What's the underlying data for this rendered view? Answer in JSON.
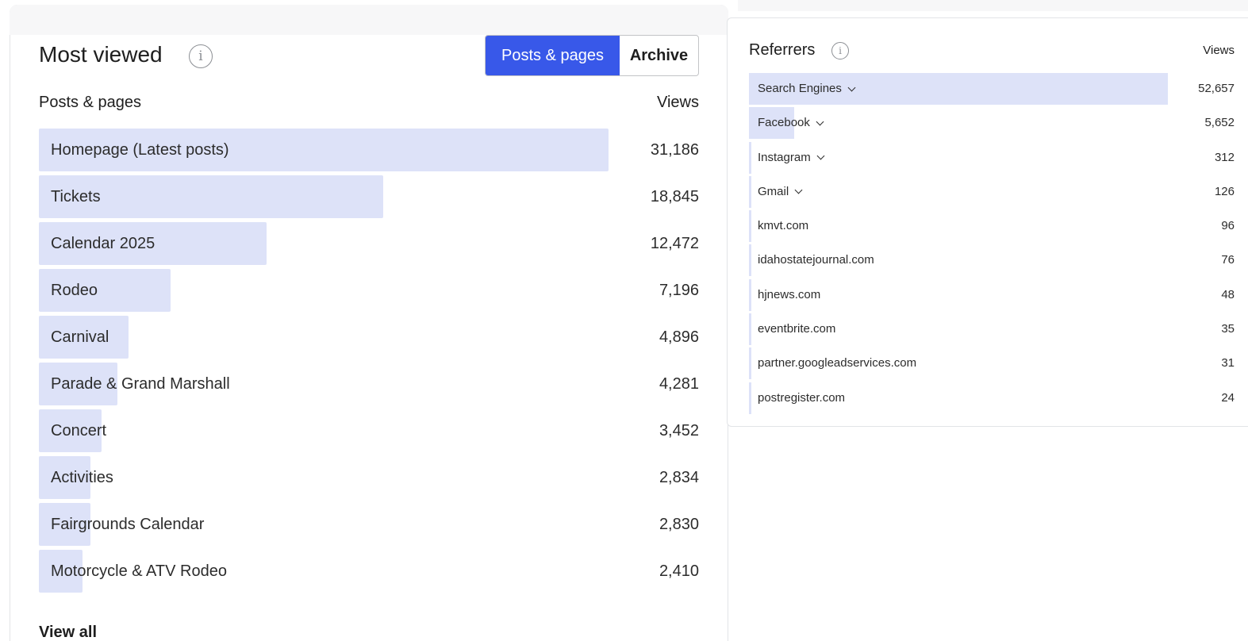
{
  "most_viewed": {
    "title": "Most viewed",
    "tabs": [
      {
        "label": "Posts & pages",
        "active": true
      },
      {
        "label": "Archive",
        "active": false
      }
    ],
    "column_label": "Posts & pages",
    "column_views": "Views",
    "max_value": 31186,
    "rows": [
      {
        "label": "Homepage (Latest posts)",
        "value": "31,186",
        "num": 31186
      },
      {
        "label": "Tickets",
        "value": "18,845",
        "num": 18845
      },
      {
        "label": "Calendar 2025",
        "value": "12,472",
        "num": 12472
      },
      {
        "label": "Rodeo",
        "value": "7,196",
        "num": 7196
      },
      {
        "label": "Carnival",
        "value": "4,896",
        "num": 4896
      },
      {
        "label": "Parade & Grand Marshall",
        "value": "4,281",
        "num": 4281
      },
      {
        "label": "Concert",
        "value": "3,452",
        "num": 3452
      },
      {
        "label": "Activities",
        "value": "2,834",
        "num": 2834
      },
      {
        "label": "Fairgrounds Calendar",
        "value": "2,830",
        "num": 2830
      },
      {
        "label": "Motorcycle & ATV Rodeo",
        "value": "2,410",
        "num": 2410
      }
    ],
    "view_all": "View all"
  },
  "referrers": {
    "title": "Referrers",
    "column_views": "Views",
    "max_value": 52657,
    "rows": [
      {
        "label": "Search Engines",
        "value": "52,657",
        "num": 52657,
        "expandable": true
      },
      {
        "label": "Facebook",
        "value": "5,652",
        "num": 5652,
        "expandable": true
      },
      {
        "label": "Instagram",
        "value": "312",
        "num": 312,
        "expandable": true
      },
      {
        "label": "Gmail",
        "value": "126",
        "num": 126,
        "expandable": true
      },
      {
        "label": "kmvt.com",
        "value": "96",
        "num": 96,
        "expandable": false
      },
      {
        "label": "idahostatejournal.com",
        "value": "76",
        "num": 76,
        "expandable": false
      },
      {
        "label": "hjnews.com",
        "value": "48",
        "num": 48,
        "expandable": false
      },
      {
        "label": "eventbrite.com",
        "value": "35",
        "num": 35,
        "expandable": false
      },
      {
        "label": "partner.googleadservices.com",
        "value": "31",
        "num": 31,
        "expandable": false
      },
      {
        "label": "postregister.com",
        "value": "24",
        "num": 24,
        "expandable": false
      }
    ]
  },
  "colors": {
    "accent": "#3858e9",
    "bar": "#dde2f8"
  },
  "icons": {
    "info": "info-icon",
    "expand": "chevron-down-icon"
  }
}
